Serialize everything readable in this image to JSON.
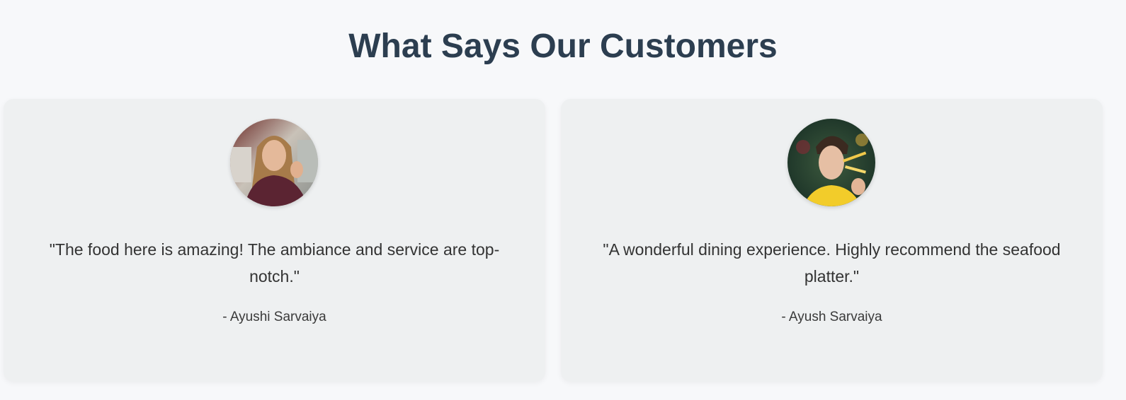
{
  "section": {
    "title": "What Says Our Customers"
  },
  "testimonials": [
    {
      "quote": "\"The food here is amazing! The ambiance and service are top-notch.\"",
      "author": "- Ayushi Sarvaiya",
      "avatar_icon": "customer-photo-woman"
    },
    {
      "quote": "\"A wonderful dining experience. Highly recommend the seafood platter.\"",
      "author": "- Ayush Sarvaiya",
      "avatar_icon": "customer-photo-man"
    }
  ],
  "colors": {
    "page_background": "#f7f8fa",
    "card_background": "#eef0f1",
    "title": "#2c3e50",
    "text": "#333333"
  }
}
